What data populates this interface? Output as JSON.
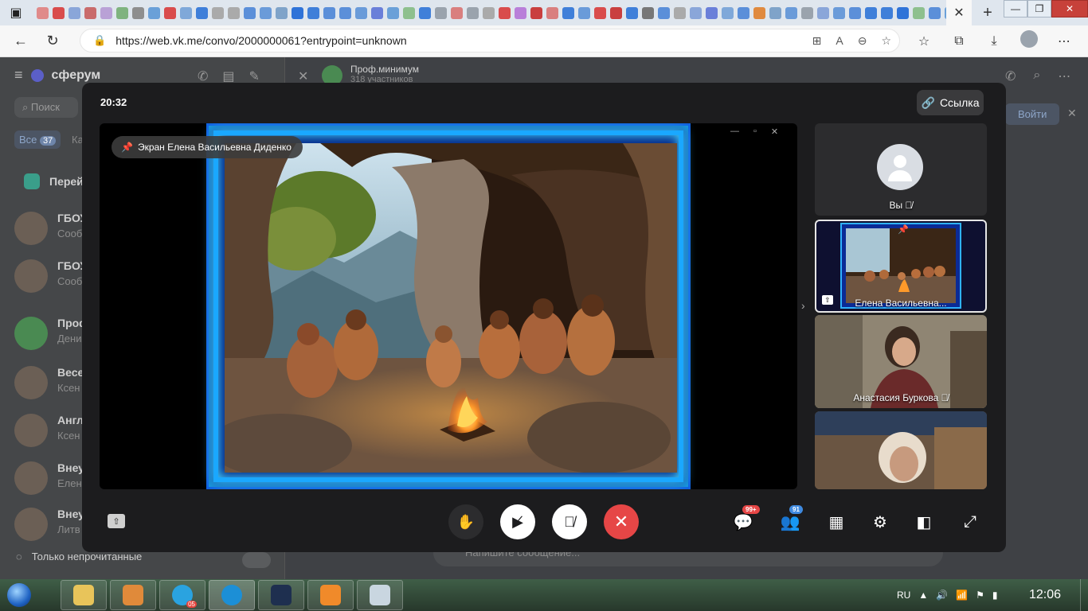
{
  "browser": {
    "url": "https://web.vk.me/convo/2000000061?entrypoint=unknown",
    "tab_icon_colors": [
      "#e08a8a",
      "#d94c4c",
      "#8aa6d9",
      "#c96b6b",
      "#b9a1d6",
      "#7fb37f",
      "#8e8e8e",
      "#6aa0d8",
      "#d94c4c",
      "#7fa8d9",
      "#3f7fd9",
      "#aaaaaa",
      "#aaaaaa",
      "#5b8fd9",
      "#6a9bd9",
      "#7fa3c9",
      "#2f73d8",
      "#3f7fd9",
      "#5b8fd9",
      "#5b8fd9",
      "#6a9bd9",
      "#6a7fd9",
      "#6aa0d8",
      "#8ec08e",
      "#3f7fd9",
      "#9aa3ad",
      "#d97f7f",
      "#9aa3ad",
      "#aaaaaa",
      "#d94c4c",
      "#b97fd9",
      "#c93f3f",
      "#d97f7f",
      "#3f7fd9",
      "#6a9bd9",
      "#d94c4c",
      "#c93f3f",
      "#3f7fd9",
      "#777777",
      "#5b8fd9",
      "#aaaaaa",
      "#8aa6d9",
      "#6a7fd9",
      "#7fa8d9",
      "#5b8fd9",
      "#e08a3f",
      "#7fa3c9",
      "#6a9bd9",
      "#9aa3ad",
      "#8aa6d9",
      "#6a9bd9",
      "#5b8fd9",
      "#3f7fd9",
      "#3f7fd9",
      "#2f73d8",
      "#8ec08e",
      "#5b8fd9",
      "#6aa0d8",
      "#d97f7f",
      "#3f7fd9",
      "#d94c4c",
      "#3f7fd9",
      "#6a9bd9"
    ]
  },
  "sidebar": {
    "brand": "сферум",
    "search_placeholder": "Поиск",
    "filter_label": "Все",
    "filter_count": "37",
    "cat_label": "Ка",
    "goto_label": "Перей",
    "chats": [
      {
        "name": "ГБОУ",
        "sub": "Сооб"
      },
      {
        "name": "ГБОУ",
        "sub": "Сооб"
      },
      {
        "name": "Проф",
        "sub": "Дени"
      },
      {
        "name": "Весе",
        "sub": "Ксен"
      },
      {
        "name": "Англ",
        "sub": "Ксен"
      },
      {
        "name": "Внеу",
        "sub": "Елена"
      },
      {
        "name": "Внеу",
        "sub": "Литв"
      }
    ],
    "unread_only": "Только непрочитанные"
  },
  "chat_header": {
    "title": "Проф.минимум",
    "subtitle": "318 участников",
    "login": "Войти",
    "message_placeholder": "Напишите сообщение..."
  },
  "call": {
    "timer": "20:32",
    "link_label": "Ссылка",
    "pinned_label": "Экран Елена Васильевна Диденко",
    "participants": [
      {
        "name": "Вы",
        "muted": true
      },
      {
        "name": "Елена Васильевна...",
        "muted": false
      },
      {
        "name": "Анастасия Буркова",
        "muted": true
      }
    ],
    "chat_badge": "99+",
    "participants_badge": "91"
  },
  "taskbar": {
    "telegram_count": "05",
    "lang": "RU",
    "clock": "12:06"
  }
}
